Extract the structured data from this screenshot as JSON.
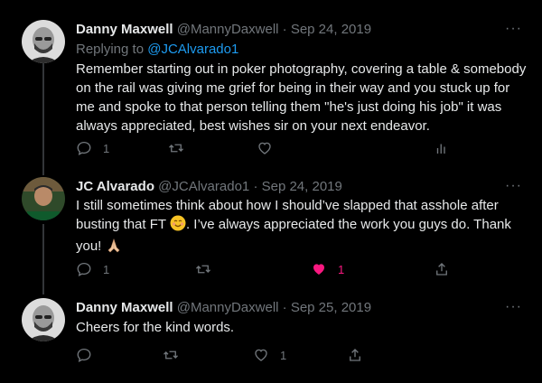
{
  "tweets": [
    {
      "name": "Danny Maxwell",
      "handle": "@MannyDaxwell",
      "sep": "·",
      "date": "Sep 24, 2019",
      "replying_prefix": "Replying to",
      "replying_to": "@JCAlvarado1",
      "text": "Remember starting out in poker photography, covering a table & somebody on the rail was giving me grief for being in their way and you stuck up for me and spoke to that person telling them \"he's just doing his job\" it was always appreciated, best wishes sir on your next endeavor.",
      "actions": {
        "reply_count": "1",
        "retweet_count": "",
        "like_count": ""
      },
      "liked": false
    },
    {
      "name": "JC Alvarado",
      "handle": "@JCAlvarado1",
      "sep": "·",
      "date": "Sep 24, 2019",
      "text_part1": "I still sometimes think about how I should’ve slapped that asshole after busting that FT ",
      "text_part2": ".  I’ve always appreciated the work you guys do. Thank you! ",
      "emojis": [
        "smiling-face-icon",
        "folded-hands-icon"
      ],
      "actions": {
        "reply_count": "1",
        "retweet_count": "",
        "like_count": "1"
      },
      "liked": true
    },
    {
      "name": "Danny Maxwell",
      "handle": "@MannyDaxwell",
      "sep": "·",
      "date": "Sep 25, 2019",
      "text": "Cheers for the kind words.",
      "actions": {
        "reply_count": "",
        "retweet_count": "",
        "like_count": "1"
      },
      "liked": false
    }
  ],
  "more_label": "···",
  "colors": {
    "background": "#000000",
    "text": "#e7e9ea",
    "muted": "#71767b",
    "link": "#1d9bf0",
    "like": "#f91880",
    "thread_line": "#333639"
  }
}
